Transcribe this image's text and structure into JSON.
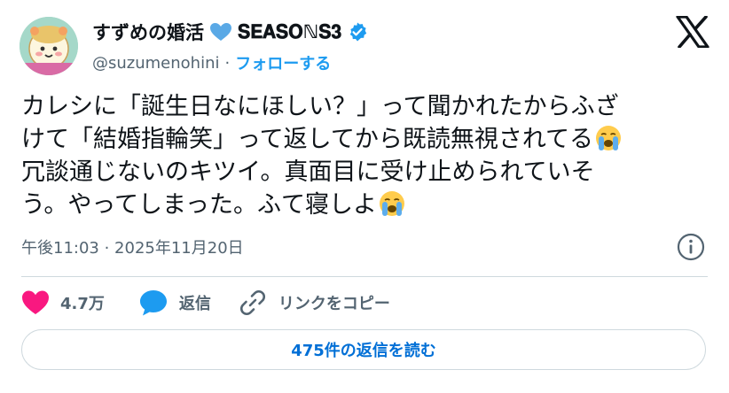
{
  "author": {
    "display_name": "すずめの婚活",
    "name_suffix": "𝐒𝐄𝐀𝐒𝐎ℕ𝐒𝟑",
    "handle": "@suzumenohini",
    "separator": "·",
    "follow_label": "フォローする",
    "verified": true
  },
  "tweet": {
    "lines": [
      "カレシに「誕生日なにほしい？」って聞かれたからふざ",
      "けて「結婚指輪笑」って返してから既読無視されてる",
      "冗談通じないのキツイ。真面目に受け止められていそ",
      "う。やってしまった。ふて寝しよ"
    ],
    "emoji_after_lines": [
      1,
      3
    ],
    "emoji": "loudly-crying-face"
  },
  "timestamp": "午後11:03 · 2025年11月20日",
  "actions": {
    "like_count": "4.7万",
    "reply_label": "返信",
    "copy_link_label": "リンクをコピー"
  },
  "read_replies_label": "475件の返信を読む",
  "colors": {
    "accent": "#1d9bf0",
    "like": "#f91880",
    "muted": "#536471",
    "text": "#0f1419",
    "border": "#cfd9de"
  }
}
